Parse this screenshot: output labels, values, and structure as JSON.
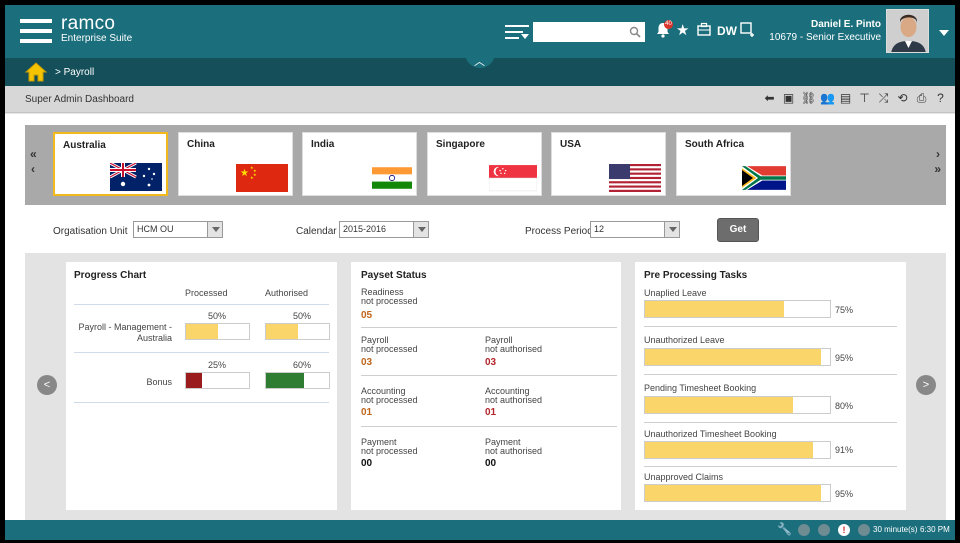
{
  "header": {
    "brand_name": "ramco",
    "brand_sub": "Enterprise Suite",
    "search_placeholder": "",
    "notification_count": "40",
    "dw_label": "DW",
    "user_name": "Daniel E. Pinto",
    "user_role": "10679 - Senior Executive",
    "accent": "#1b6f7c"
  },
  "breadcrumb": {
    "path": "> Payroll"
  },
  "page": {
    "title": "Super Admin Dashboard"
  },
  "countries": [
    {
      "name": "Australia",
      "flag": "australia",
      "selected": true
    },
    {
      "name": "China",
      "flag": "china",
      "selected": false
    },
    {
      "name": "India",
      "flag": "india",
      "selected": false
    },
    {
      "name": "Singapore",
      "flag": "singapore",
      "selected": false
    },
    {
      "name": "USA",
      "flag": "usa",
      "selected": false
    },
    {
      "name": "South Africa",
      "flag": "south-africa",
      "selected": false
    }
  ],
  "filters": {
    "org_label": "Orgatisation Unit",
    "org_value": "HCM OU",
    "calendar_label": "Calendar",
    "calendar_value": "2015-2016",
    "period_label": "Process Period",
    "period_value": "12",
    "get_label": "Get"
  },
  "progress_chart": {
    "title": "Progress Chart",
    "col_processed": "Processed",
    "col_authorised": "Authorised",
    "rows": [
      {
        "label_line1": "Payroll - Management -",
        "label_line2": "Australia",
        "processed_pct": "50%",
        "processed": 50,
        "processed_color": "#f9d56a",
        "authorised_pct": "50%",
        "authorised": 50,
        "authorised_color": "#f9d56a"
      },
      {
        "label_line1": "Bonus",
        "label_line2": "",
        "processed_pct": "25%",
        "processed": 25,
        "processed_color": "#9b1c1c",
        "authorised_pct": "60%",
        "authorised": 60,
        "authorised_color": "#2f7d32"
      }
    ]
  },
  "payset": {
    "title": "Payset Status",
    "readiness": {
      "l1": "Readiness",
      "l2": "not processed",
      "value": "05"
    },
    "payroll_np": {
      "l1": "Payroll",
      "l2": "not processed",
      "value": "03"
    },
    "payroll_na": {
      "l1": "Payroll",
      "l2": "not authorised",
      "value": "03"
    },
    "accounting_np": {
      "l1": "Accounting",
      "l2": "not processed",
      "value": "01"
    },
    "accounting_na": {
      "l1": "Accounting",
      "l2": "not authorised",
      "value": "01"
    },
    "payment_np": {
      "l1": "Payment",
      "l2": "not processed",
      "value": "00"
    },
    "payment_na": {
      "l1": "Payment",
      "l2": "not authorised",
      "value": "00"
    }
  },
  "preprocessing": {
    "title": "Pre Processing Tasks",
    "tasks": [
      {
        "label": "Unaplied Leave",
        "pct": "75%",
        "value": 75
      },
      {
        "label": "Unauthorized Leave",
        "pct": "95%",
        "value": 95
      },
      {
        "label": "Pending Timesheet Booking",
        "pct": "80%",
        "value": 80
      },
      {
        "label": "Unauthorized Timesheet Booking",
        "pct": "91%",
        "value": 91
      },
      {
        "label": "Unapproved Claims",
        "pct": "95%",
        "value": 95
      }
    ]
  },
  "footer": {
    "session": "30 minute(s)",
    "time": "6:30 PM"
  }
}
